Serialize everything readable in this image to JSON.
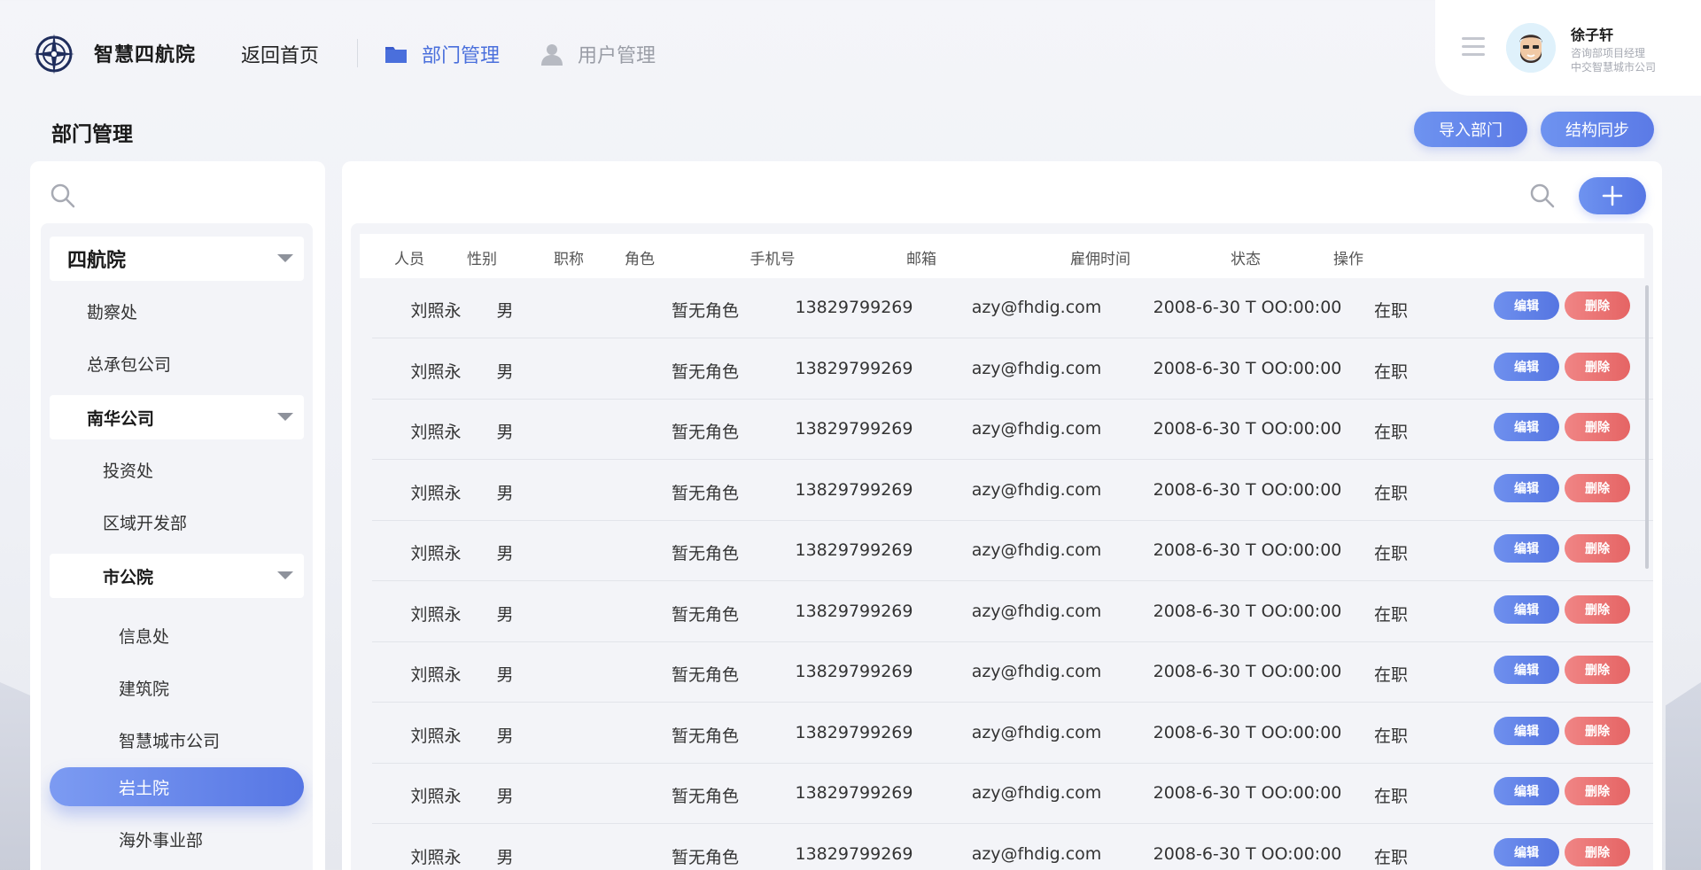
{
  "header": {
    "brand": "智慧四航院",
    "back_home": "返回首页",
    "nav": {
      "dept": "部门管理",
      "user": "用户管理"
    }
  },
  "user": {
    "name": "徐子轩",
    "role": "咨询部项目经理",
    "company": "中交智慧城市公司"
  },
  "page": {
    "title": "部门管理",
    "import_btn": "导入部门",
    "sync_btn": "结构同步"
  },
  "tree": [
    {
      "label": "四航院",
      "type": "group"
    },
    {
      "label": "勘察处",
      "type": "item"
    },
    {
      "label": "总承包公司",
      "type": "item"
    },
    {
      "label": "南华公司",
      "type": "group"
    },
    {
      "label": "投资处",
      "type": "item"
    },
    {
      "label": "区域开发部",
      "type": "item"
    },
    {
      "label": "市公院",
      "type": "group"
    },
    {
      "label": "信息处",
      "type": "item"
    },
    {
      "label": "建筑院",
      "type": "item"
    },
    {
      "label": "智慧城市公司",
      "type": "item"
    },
    {
      "label": "岩土院",
      "type": "active"
    },
    {
      "label": "海外事业部",
      "type": "item"
    }
  ],
  "table": {
    "headers": [
      "人员",
      "性别",
      "职称",
      "角色",
      "手机号",
      "邮箱",
      "雇佣时间",
      "状态",
      "操作"
    ],
    "edit_label": "编辑",
    "delete_label": "删除",
    "rows": [
      {
        "name": "刘照永",
        "gender": "男",
        "title": "",
        "role": "暂无角色",
        "phone": "13829799269",
        "email": "azy@fhdig.com",
        "hired": "2008-6-30 T OO:00:00",
        "status": "在职"
      },
      {
        "name": "刘照永",
        "gender": "男",
        "title": "",
        "role": "暂无角色",
        "phone": "13829799269",
        "email": "azy@fhdig.com",
        "hired": "2008-6-30 T OO:00:00",
        "status": "在职"
      },
      {
        "name": "刘照永",
        "gender": "男",
        "title": "",
        "role": "暂无角色",
        "phone": "13829799269",
        "email": "azy@fhdig.com",
        "hired": "2008-6-30 T OO:00:00",
        "status": "在职"
      },
      {
        "name": "刘照永",
        "gender": "男",
        "title": "",
        "role": "暂无角色",
        "phone": "13829799269",
        "email": "azy@fhdig.com",
        "hired": "2008-6-30 T OO:00:00",
        "status": "在职"
      },
      {
        "name": "刘照永",
        "gender": "男",
        "title": "",
        "role": "暂无角色",
        "phone": "13829799269",
        "email": "azy@fhdig.com",
        "hired": "2008-6-30 T OO:00:00",
        "status": "在职"
      },
      {
        "name": "刘照永",
        "gender": "男",
        "title": "",
        "role": "暂无角色",
        "phone": "13829799269",
        "email": "azy@fhdig.com",
        "hired": "2008-6-30 T OO:00:00",
        "status": "在职"
      },
      {
        "name": "刘照永",
        "gender": "男",
        "title": "",
        "role": "暂无角色",
        "phone": "13829799269",
        "email": "azy@fhdig.com",
        "hired": "2008-6-30 T OO:00:00",
        "status": "在职"
      },
      {
        "name": "刘照永",
        "gender": "男",
        "title": "",
        "role": "暂无角色",
        "phone": "13829799269",
        "email": "azy@fhdig.com",
        "hired": "2008-6-30 T OO:00:00",
        "status": "在职"
      },
      {
        "name": "刘照永",
        "gender": "男",
        "title": "",
        "role": "暂无角色",
        "phone": "13829799269",
        "email": "azy@fhdig.com",
        "hired": "2008-6-30 T OO:00:00",
        "status": "在职"
      },
      {
        "name": "刘照永",
        "gender": "男",
        "title": "",
        "role": "暂无角色",
        "phone": "13829799269",
        "email": "azy@fhdig.com",
        "hired": "2008-6-30 T OO:00:00",
        "status": "在职"
      }
    ]
  },
  "colors": {
    "accent": "#5b7ae6",
    "danger": "#e56464",
    "nav_active": "#4a6fdc"
  },
  "icons": {
    "logo": "compass-logo-icon",
    "dept": "folder-icon",
    "user": "user-icon",
    "menu": "hamburger-icon",
    "search": "search-icon",
    "add": "plus-icon"
  }
}
